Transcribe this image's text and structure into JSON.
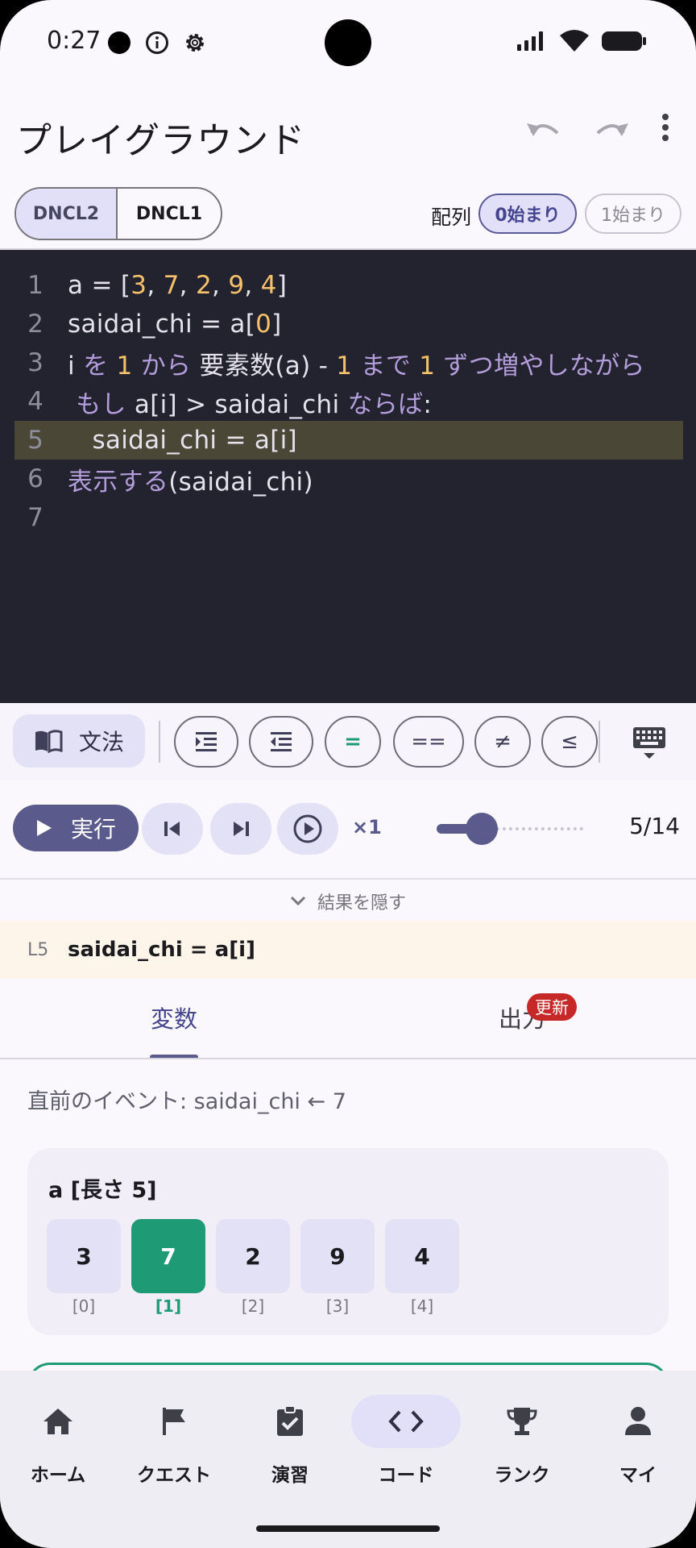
{
  "status_bar": {
    "time": "0:27"
  },
  "app_bar": {
    "title": "プレイグラウンド"
  },
  "language_toggle": {
    "options": [
      "DNCL2",
      "DNCL1"
    ],
    "selected": "DNCL2"
  },
  "array_index": {
    "label": "配列",
    "options": [
      "0始まり",
      "1始まり"
    ],
    "selected": "0始まり"
  },
  "editor": {
    "line_numbers": [
      "1",
      "2",
      "3",
      "4",
      "5",
      "6",
      "7"
    ],
    "highlighted_line": 5,
    "lines": [
      "a = [3, 7, 2, 9, 4]",
      "saidai_chi = a[0]",
      "i を 1 から 要素数(a) - 1 まで 1 ずつ増やしながら",
      " もし a[i] > saidai_chi ならば:",
      "   saidai_chi = a[i]",
      "表示する(saidai_chi)",
      ""
    ]
  },
  "toolbar": {
    "grammar_label": "文法",
    "symbols": [
      "=",
      "==",
      "≠",
      "≤"
    ]
  },
  "playback": {
    "run_label": "実行",
    "speed": "×1",
    "current_step": 5,
    "total_steps": 14,
    "step_text": "5/14"
  },
  "results": {
    "toggle_label": "結果を隠す",
    "current_line_label": "L5",
    "current_line_code": "saidai_chi = a[i]"
  },
  "tabs": {
    "items": [
      "変数",
      "出力"
    ],
    "active": "変数",
    "badge": "更新"
  },
  "event_text": "直前のイベント: saidai_chi ← 7",
  "array_view": {
    "title": "a [長さ 5]",
    "values": [
      "3",
      "7",
      "2",
      "9",
      "4"
    ],
    "indices": [
      "[0]",
      "[1]",
      "[2]",
      "[3]",
      "[4]"
    ],
    "highlighted_index": 1
  },
  "bottom_nav": {
    "items": [
      "ホーム",
      "クエスト",
      "演習",
      "コード",
      "ランク",
      "マイ"
    ],
    "active": "コード"
  },
  "colors": {
    "accent": "#5a5a8c",
    "highlight_green": "#1e9a74",
    "editor_bg": "#23222f",
    "keyword": "#b39ddb",
    "number": "#f6c16b",
    "badge_red": "#c62828"
  }
}
